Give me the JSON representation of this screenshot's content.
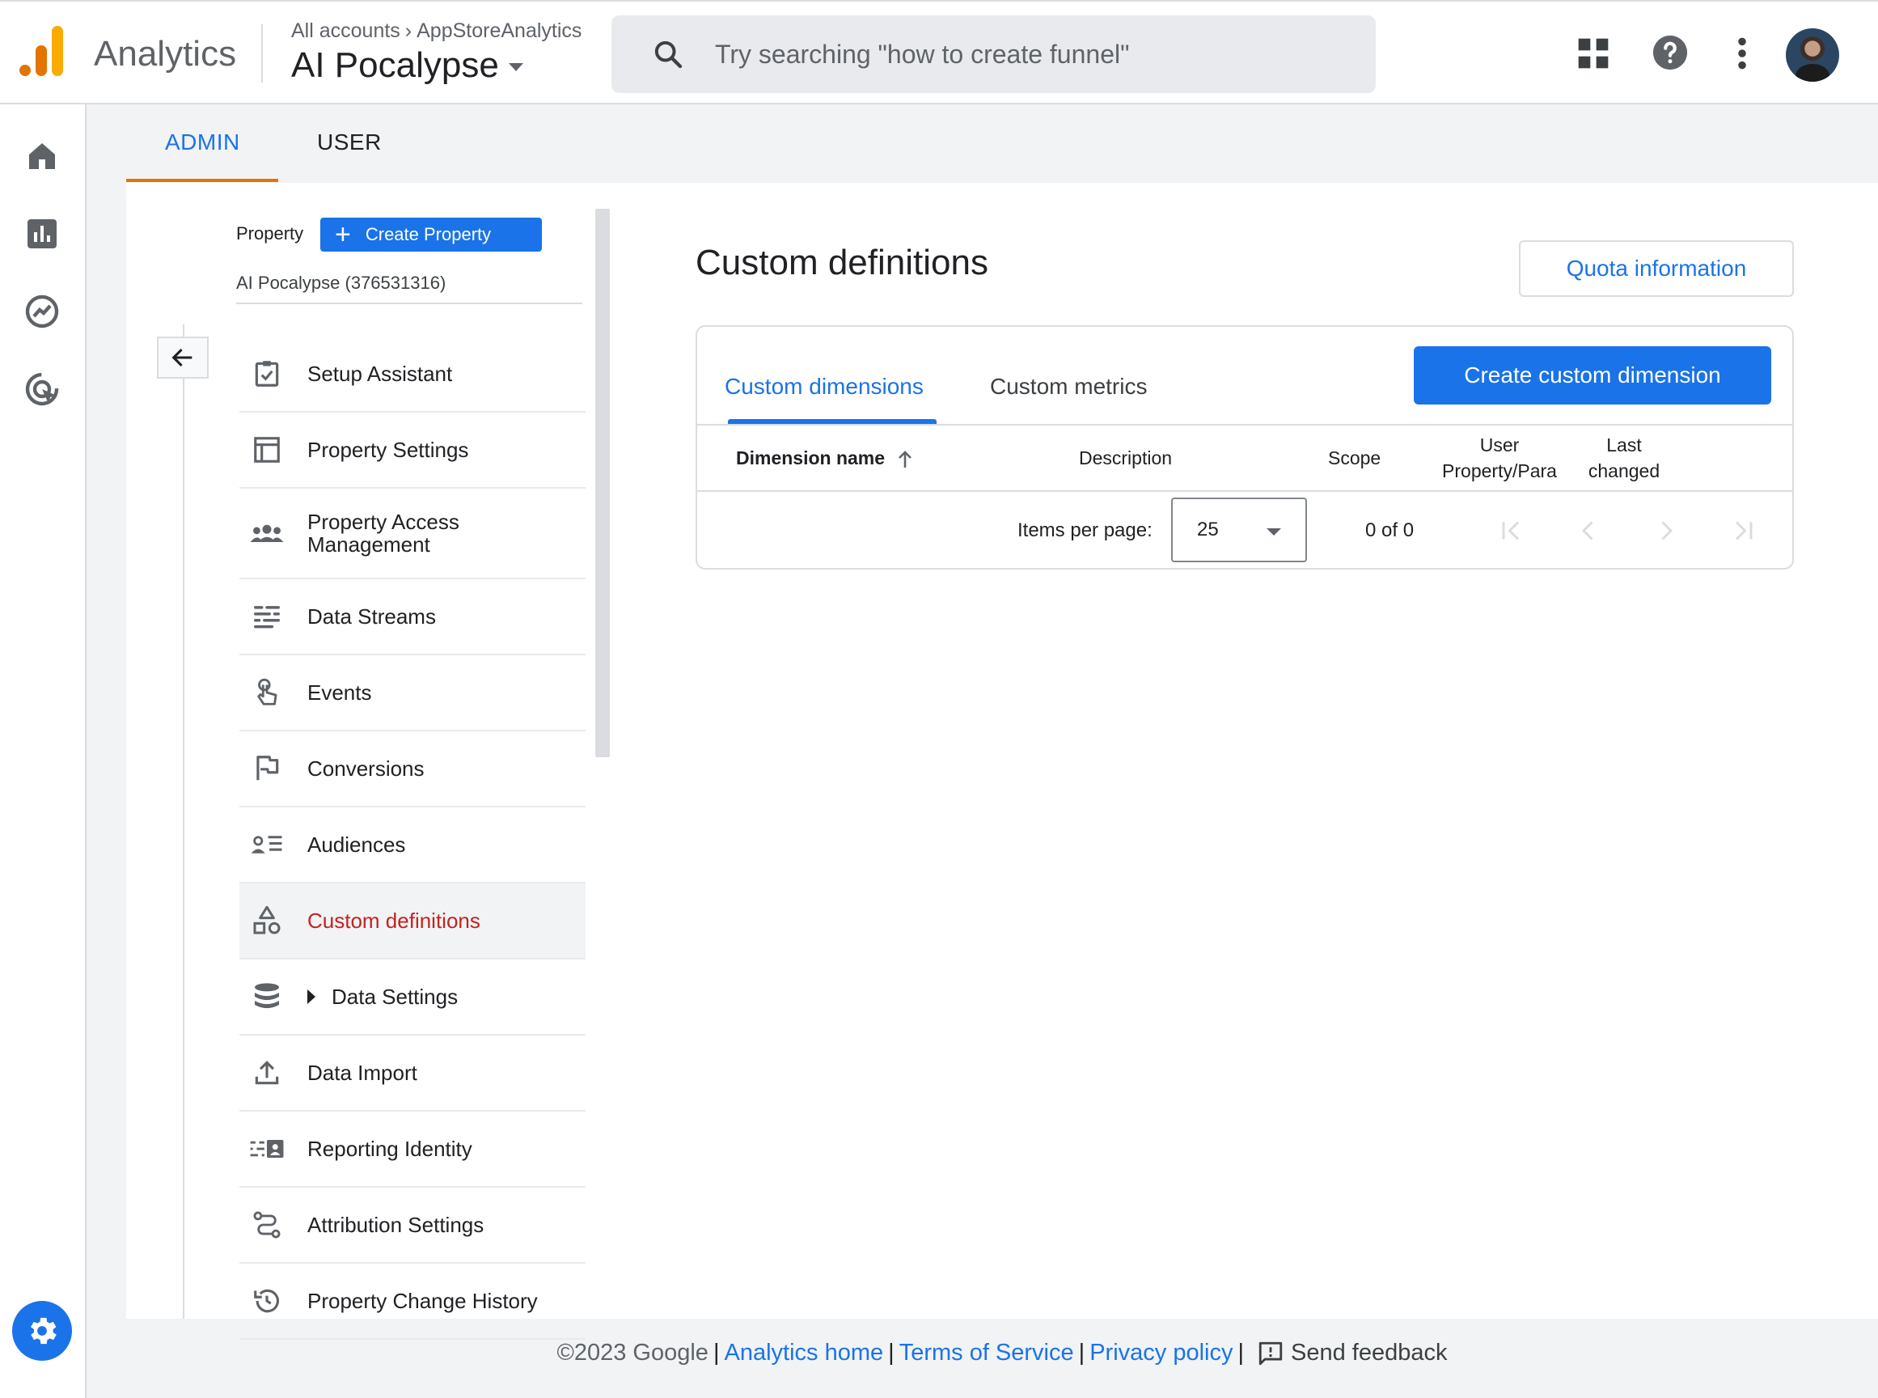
{
  "app": {
    "name": "Analytics",
    "breadcrumb_accounts": "All accounts",
    "breadcrumb_account": "AppStoreAnalytics",
    "property_title": "AI Pocalypse",
    "search_placeholder": "Try searching \"how to create funnel\""
  },
  "admin_tabs": [
    {
      "label": "ADMIN",
      "active": true
    },
    {
      "label": "USER",
      "active": false
    }
  ],
  "property_panel": {
    "label": "Property",
    "create_button": "Create Property",
    "property_name": "AI Pocalypse (376531316)",
    "menu": [
      {
        "label": "Setup Assistant",
        "icon": "checklist-icon"
      },
      {
        "label": "Property Settings",
        "icon": "layout-icon"
      },
      {
        "label": "Property Access Management",
        "icon": "people-icon"
      },
      {
        "label": "Data Streams",
        "icon": "streams-icon"
      },
      {
        "label": "Events",
        "icon": "touch-icon"
      },
      {
        "label": "Conversions",
        "icon": "flag-icon"
      },
      {
        "label": "Audiences",
        "icon": "audiences-icon"
      },
      {
        "label": "Custom definitions",
        "icon": "shapes-icon",
        "active": true
      },
      {
        "label": "Data Settings",
        "icon": "database-icon"
      },
      {
        "label": "Data Import",
        "icon": "upload-icon"
      },
      {
        "label": "Reporting Identity",
        "icon": "identity-icon"
      },
      {
        "label": "Attribution Settings",
        "icon": "attribution-icon"
      },
      {
        "label": "Property Change History",
        "icon": "history-icon"
      }
    ]
  },
  "main": {
    "title": "Custom definitions",
    "quota_button": "Quota information",
    "tabs": [
      {
        "label": "Custom dimensions",
        "active": true
      },
      {
        "label": "Custom metrics",
        "active": false
      }
    ],
    "create_button": "Create custom dimension",
    "columns": {
      "name": "Dimension name",
      "description": "Description",
      "scope": "Scope",
      "user_line1": "User",
      "user_line2": "Property/Para",
      "last_line1": "Last",
      "last_line2": "changed"
    },
    "items_per_page_label": "Items per page:",
    "items_per_page_value": "25",
    "range": "0 of 0"
  },
  "footer": {
    "copyright": "©2023 Google",
    "links": [
      "Analytics home",
      "Terms of Service",
      "Privacy policy"
    ],
    "separator": "|",
    "feedback": "Send feedback"
  },
  "colors": {
    "accent": "#1a73e8",
    "active_nav": "#c5221f",
    "tab_underline": "#e37400"
  }
}
